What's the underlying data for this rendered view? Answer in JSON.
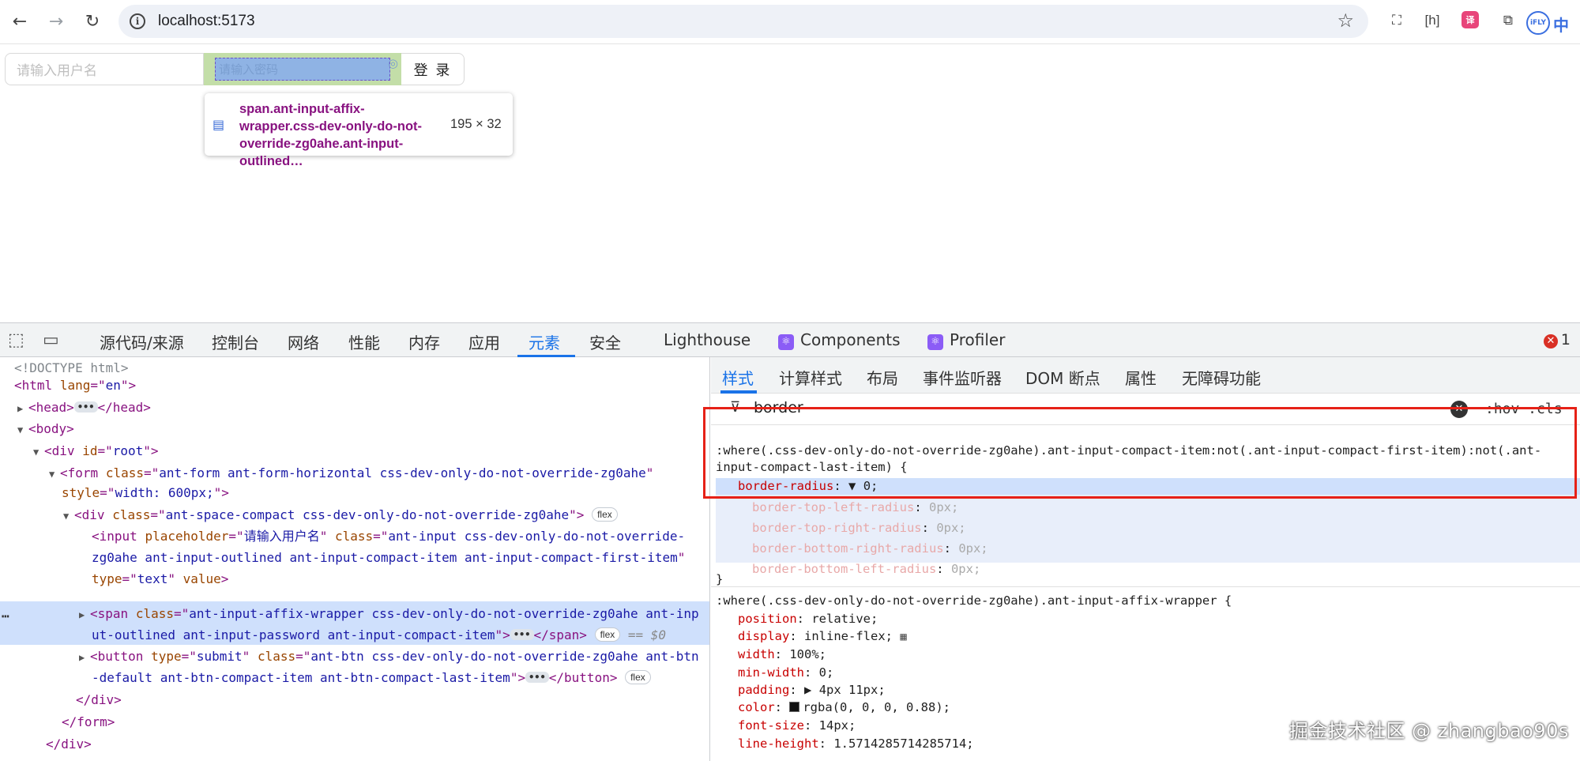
{
  "browser": {
    "url": "localhost:5173",
    "ext_zh": "中",
    "ext_iflyt": "iFLY",
    "ext_hw": "[h]",
    "ext_tr": "译"
  },
  "page": {
    "username_placeholder": "请输入用户名",
    "password_placeholder": "请输入密码",
    "login_label": "登 录",
    "tooltip_name": "span.ant-input-affix-wrapper.css-dev-only-do-not-override-zg0ahe.ant-input-outlined…",
    "tooltip_size": "195 × 32"
  },
  "devtools": {
    "tabs": [
      "源代码/来源",
      "控制台",
      "网络",
      "性能",
      "内存",
      "应用",
      "元素",
      "安全",
      "Lighthouse",
      "Components",
      "Profiler"
    ],
    "active_tab": "元素",
    "error_count": "1",
    "styles_tabs": [
      "样式",
      "计算样式",
      "布局",
      "事件监听器",
      "DOM 断点",
      "属性",
      "无障碍功能"
    ],
    "filter_value": "border",
    "hov_cls": ":hov .cls",
    "dom_lines": {
      "l0": "<!DOCTYPE html>",
      "l1_tag": "html",
      "l1_attr": "lang",
      "l1_val": "en",
      "l2_tag": "head",
      "l3_tag": "body",
      "l4_tag": "div",
      "l4_attr": "id",
      "l4_val": "root",
      "l5_tag": "form",
      "l5_attr": "class",
      "l5_val": "ant-form ant-form-horizontal css-dev-only-do-not-override-zg0ahe",
      "l5b_attr": "style",
      "l5b_val": "width: 600px;",
      "l6_tag": "div",
      "l6_attr": "class",
      "l6_val": "ant-space-compact css-dev-only-do-not-override-zg0ahe",
      "l7_tag": "input",
      "l7_a1": "placeholder",
      "l7_v1": "请输入用户名",
      "l7_a2": "class",
      "l7_v2": "ant-input css-dev-only-do-not-override-",
      "l7b": "zg0ahe ant-input-outlined ant-input-compact-item ant-input-compact-first-item",
      "l7c_a1": "type",
      "l7c_v1": "text",
      "l7c_a2": "value",
      "l8_tag": "span",
      "l8_attr": "class",
      "l8_val": "ant-input-affix-wrapper css-dev-only-do-not-override-zg0ahe ant-inp",
      "l8b": "ut-outlined ant-input-password ant-input-compact-item",
      "l8_eq": "== $0",
      "l9_tag": "button",
      "l9_a1": "type",
      "l9_v1": "submit",
      "l9_a2": "class",
      "l9_v2": "ant-btn css-dev-only-do-not-override-zg0ahe ant-btn",
      "l9b": "-default ant-btn-compact-item ant-btn-compact-last-item",
      "l10": "</div>",
      "l11": "</form>",
      "l12": "</div>",
      "flex": "flex",
      "dots": "•••"
    },
    "rule1": {
      "selector1": ":where(.css-dev-only-do-not-override-zg0ahe).ant-input-compact-item:not(.ant-input-compact-first-item):not(.ant-",
      "selector2": "input-compact-last-item) {",
      "main_prop": "border-radius",
      "main_val": "0;",
      "sub": [
        {
          "p": "border-top-left-radius",
          "v": "0px;"
        },
        {
          "p": "border-top-right-radius",
          "v": "0px;"
        },
        {
          "p": "border-bottom-right-radius",
          "v": "0px;"
        },
        {
          "p": "border-bottom-left-radius",
          "v": "0px;"
        }
      ],
      "close": "}"
    },
    "rule2": {
      "selector": ":where(.css-dev-only-do-not-override-zg0ahe).ant-input-affix-wrapper {",
      "props": [
        {
          "p": "position",
          "v": "relative;"
        },
        {
          "p": "display",
          "v": "inline-flex;"
        },
        {
          "p": "width",
          "v": "100%;"
        },
        {
          "p": "min-width",
          "v": "0;"
        },
        {
          "p": "padding",
          "v": "4px 11px;"
        },
        {
          "p": "color",
          "v": "rgba(0, 0, 0, 0.88);"
        },
        {
          "p": "font-size",
          "v": "14px;"
        },
        {
          "p": "line-height",
          "v": "1.5714285714285714;"
        }
      ]
    }
  },
  "watermark": "掘金技术社区 @ zhangbao90s",
  "colors": {
    "accent": "#1a73e8",
    "highlight_box": "#e62117",
    "tag": "#881280",
    "attr_name": "#994500",
    "attr_value": "#1a1aa6"
  }
}
